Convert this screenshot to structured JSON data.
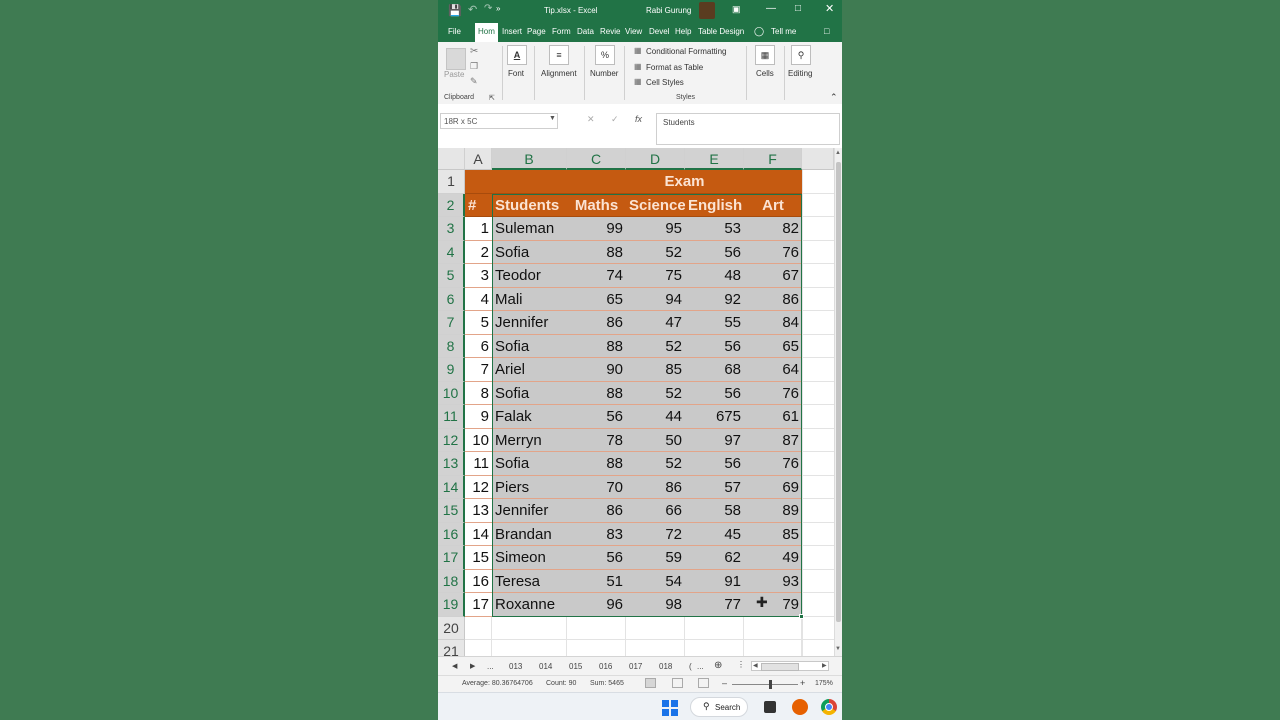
{
  "window": {
    "filename": "Tip.xlsx",
    "separator": "-",
    "app": "Excel",
    "user": "Rabi Gurung"
  },
  "tabs": [
    "File",
    "Hom",
    "Insert",
    "Page",
    "Form",
    "Data",
    "Revie",
    "View",
    "Devel",
    "Help",
    "Table Design",
    "Tell me"
  ],
  "ribbon": {
    "paste": "Paste",
    "clipboard": "Clipboard",
    "font": "Font",
    "alignment": "Alignment",
    "number": "Number",
    "number_symbol": "%",
    "font_symbol": "A",
    "conditional": "Conditional Formatting",
    "format_table": "Format as Table",
    "cell_styles": "Cell Styles",
    "styles": "Styles",
    "cells": "Cells",
    "editing": "Editing"
  },
  "formula_bar": {
    "name_box": "18R x 5C",
    "fx": "fx",
    "value": "Students"
  },
  "columns": [
    "A",
    "B",
    "C",
    "D",
    "E",
    "F"
  ],
  "table": {
    "title": "Exam",
    "headers": [
      "#",
      "Students",
      "Maths",
      "Science",
      "English",
      "Art"
    ],
    "rows": [
      [
        "1",
        "Suleman",
        "99",
        "95",
        "53",
        "82"
      ],
      [
        "2",
        "Sofia",
        "88",
        "52",
        "56",
        "76"
      ],
      [
        "3",
        "Teodor",
        "74",
        "75",
        "48",
        "67"
      ],
      [
        "4",
        "Mali",
        "65",
        "94",
        "92",
        "86"
      ],
      [
        "5",
        "Jennifer",
        "86",
        "47",
        "55",
        "84"
      ],
      [
        "6",
        "Sofia",
        "88",
        "52",
        "56",
        "65"
      ],
      [
        "7",
        "Ariel",
        "90",
        "85",
        "68",
        "64"
      ],
      [
        "8",
        "Sofia",
        "88",
        "52",
        "56",
        "76"
      ],
      [
        "9",
        "Falak",
        "56",
        "44",
        "675",
        "61"
      ],
      [
        "10",
        "Merryn",
        "78",
        "50",
        "97",
        "87"
      ],
      [
        "11",
        "Sofia",
        "88",
        "52",
        "56",
        "76"
      ],
      [
        "12",
        "Piers",
        "70",
        "86",
        "57",
        "69"
      ],
      [
        "13",
        "Jennifer",
        "86",
        "66",
        "58",
        "89"
      ],
      [
        "14",
        "Brandan",
        "83",
        "72",
        "45",
        "85"
      ],
      [
        "15",
        "Simeon",
        "56",
        "59",
        "62",
        "49"
      ],
      [
        "16",
        "Teresa",
        "51",
        "54",
        "91",
        "93"
      ],
      [
        "17",
        "Roxanne",
        "96",
        "98",
        "77",
        "79"
      ]
    ]
  },
  "row_numbers": [
    "1",
    "2",
    "3",
    "4",
    "5",
    "6",
    "7",
    "8",
    "9",
    "10",
    "11",
    "12",
    "13",
    "14",
    "15",
    "16",
    "17",
    "18",
    "19",
    "20",
    "21"
  ],
  "sheets": [
    "...",
    "013",
    "014",
    "015",
    "016",
    "017",
    "018",
    "(",
    "..."
  ],
  "status": {
    "average": "Average: 80.36764706",
    "count": "Count: 90",
    "sum": "Sum: 5465",
    "zoom": "175%"
  },
  "taskbar": {
    "search": "Search"
  },
  "colors": {
    "excel_green": "#217346",
    "header_orange": "#c55a11",
    "band_gray": "#c9c9c9"
  }
}
